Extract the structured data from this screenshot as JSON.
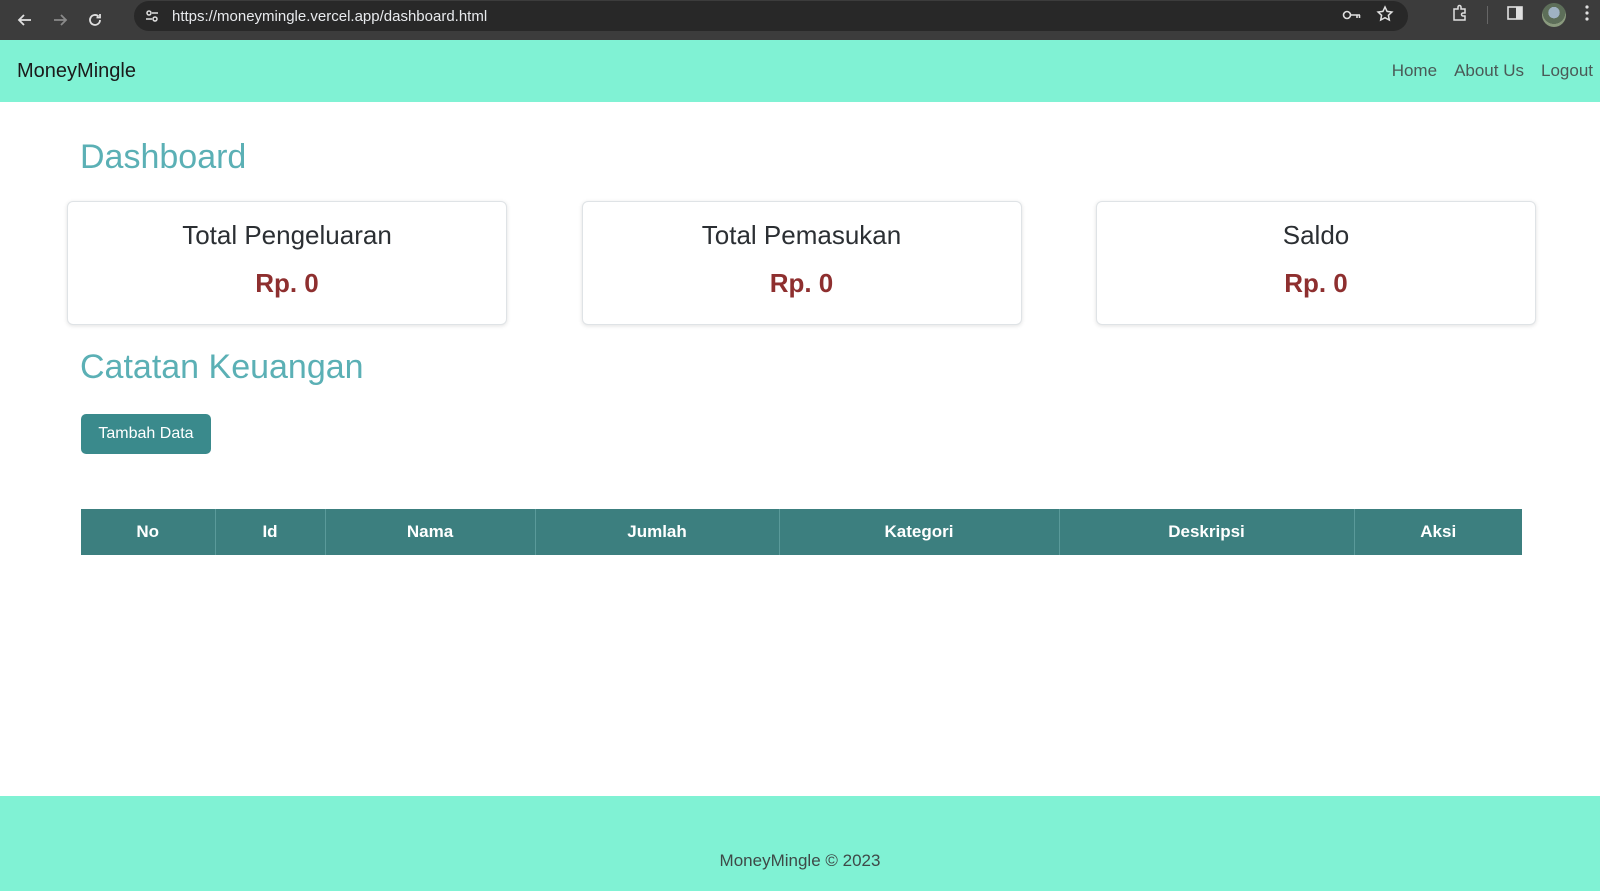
{
  "browser": {
    "url": "https://moneymingle.vercel.app/dashboard.html"
  },
  "navbar": {
    "brand": "MoneyMingle",
    "links": [
      "Home",
      "About Us",
      "Logout"
    ]
  },
  "dashboard": {
    "title": "Dashboard",
    "cards": [
      {
        "title": "Total Pengeluaran",
        "value": "Rp. 0"
      },
      {
        "title": "Total Pemasukan",
        "value": "Rp. 0"
      },
      {
        "title": "Saldo",
        "value": "Rp. 0"
      }
    ]
  },
  "records": {
    "title": "Catatan Keuangan",
    "add_button_label": "Tambah Data",
    "columns": [
      "No",
      "Id",
      "Nama",
      "Jumlah",
      "Kategori",
      "Deskripsi",
      "Aksi"
    ],
    "rows": []
  },
  "footer": {
    "text": "MoneyMingle © 2023"
  },
  "colors": {
    "accent": "#80f2d4",
    "heading": "#5bb0b5",
    "table_header": "#3c7f7f",
    "value": "#8e2f2f"
  }
}
